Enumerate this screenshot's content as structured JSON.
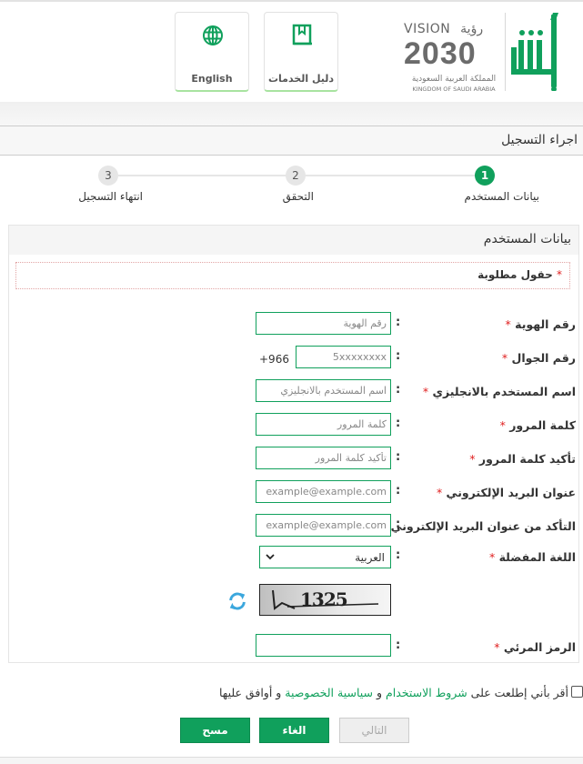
{
  "header": {
    "brand_name": "أبشر",
    "vision": {
      "top_en": "VISION",
      "top_ar": "رؤية",
      "year": "2030",
      "kingdom_ar": "المملكة العربية السعودية",
      "kingdom_en": "KINGDOM OF SAUDI ARABIA"
    },
    "buttons": [
      {
        "label": "دليل الخدمات",
        "icon": "book-bookmark-icon"
      },
      {
        "label": "English",
        "icon": "globe-icon"
      }
    ]
  },
  "page": {
    "title": "اجراء التسجيل"
  },
  "stepper": {
    "steps": [
      {
        "number": "1",
        "label": "بيانات المستخدم",
        "state": "active"
      },
      {
        "number": "2",
        "label": "التحقق",
        "state": "pending"
      },
      {
        "number": "3",
        "label": "انتهاء التسجيل",
        "state": "pending"
      }
    ]
  },
  "form": {
    "section_title": "بيانات المستخدم",
    "required_note": "حقول مطلوبة",
    "required_mark": "*",
    "colon": ":",
    "fields": {
      "id_number": {
        "label": "رقم الهوية",
        "placeholder": "رقم الهوية",
        "value": ""
      },
      "mobile": {
        "label": "رقم الجوال",
        "placeholder": "5xxxxxxxx",
        "prefix": "+966",
        "value": ""
      },
      "username_en": {
        "label": "اسم المستخدم بالانجليزي",
        "placeholder": "اسم المستخدم بالانجليزي",
        "value": ""
      },
      "password": {
        "label": "كلمة المرور",
        "placeholder": "كلمة المرور",
        "value": ""
      },
      "password_confirm": {
        "label": "تأكيد كلمة المرور",
        "placeholder": "تأكيد كلمة المرور",
        "value": ""
      },
      "email": {
        "label": "عنوان البريد الإلكتروني",
        "placeholder": "example@example.com",
        "value": ""
      },
      "email_confirm": {
        "label": "التأكد من عنوان البريد الإلكتروني",
        "placeholder": "example@example.com",
        "value": ""
      },
      "language": {
        "label": "اللغة المفضلة",
        "selected": "العربية"
      },
      "captcha": {
        "label": "الرمز المرئي",
        "image_text": "1325",
        "value": ""
      }
    }
  },
  "terms": {
    "prefix": "أقر بأني إطلعت على",
    "terms_link": "شروط الاستخدام",
    "conjunction": "و",
    "privacy_link": "سياسية الخصوصية",
    "suffix": "و أوافق عليها",
    "checked": false
  },
  "actions": {
    "next_label": "التالي",
    "cancel_label": "الغاء",
    "clear_label": "مسح"
  },
  "colors": {
    "brand_green": "#10a05c",
    "required_red": "#e02020",
    "refresh_blue": "#3ba7dd"
  }
}
